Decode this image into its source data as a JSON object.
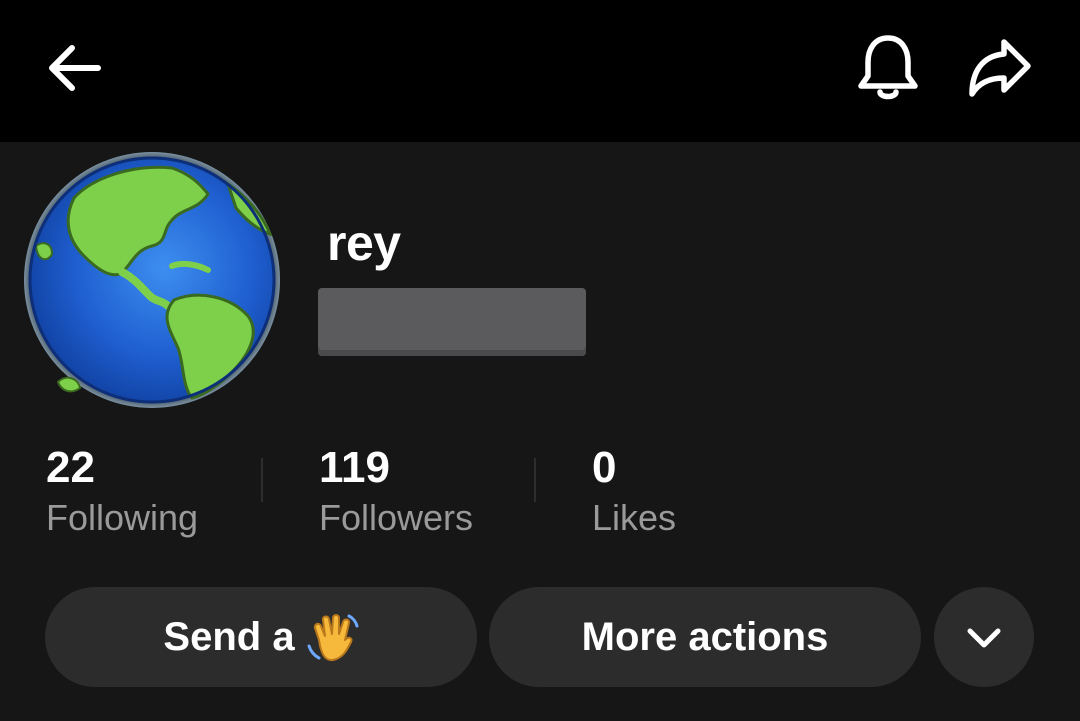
{
  "header": {
    "back_icon": "arrow-left-icon",
    "bell_icon": "bell-icon",
    "share_icon": "share-arrow-icon"
  },
  "profile": {
    "avatar_icon": "globe-americas-icon",
    "username": "rey"
  },
  "stats": [
    {
      "value": "22",
      "label": "Following"
    },
    {
      "value": "119",
      "label": "Followers"
    },
    {
      "value": "0",
      "label": "Likes"
    }
  ],
  "actions": {
    "send_label": "Send a",
    "send_icon": "waving-hand-icon",
    "more_label": "More actions",
    "chevron_icon": "chevron-down-icon"
  },
  "colors": {
    "background": "#161616",
    "topbar": "#000000",
    "button": "#2c2c2c",
    "label": "#9a9a9a"
  }
}
